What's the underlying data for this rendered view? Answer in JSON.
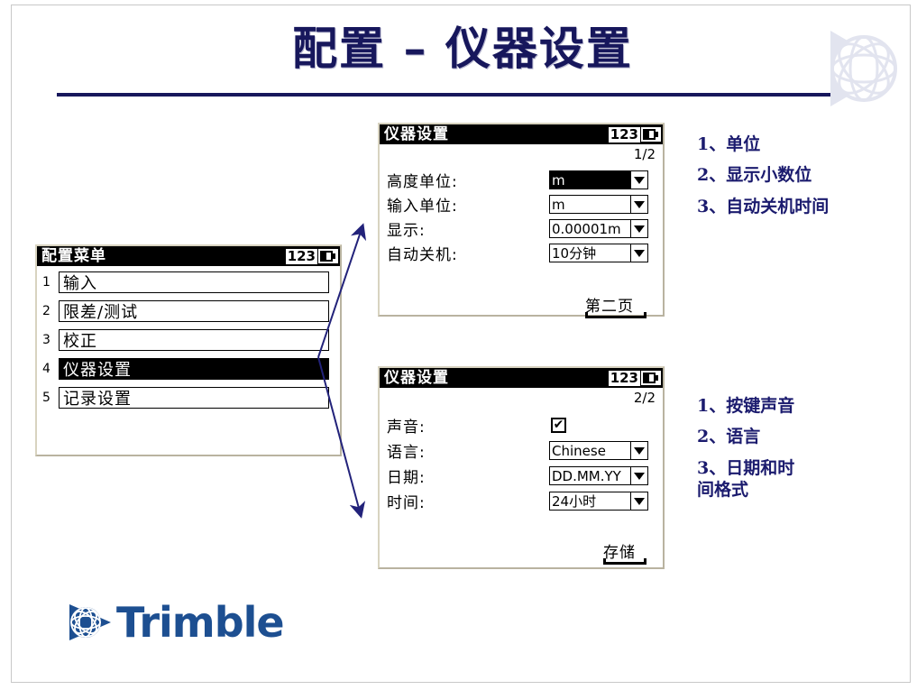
{
  "slide": {
    "title": "配置 – 仪器设置",
    "accent_color": "#17175c",
    "brand_color": "#1d4f91",
    "logo_name": "trimble-globe-logo",
    "footer_wordmark": "Trimble"
  },
  "menu_screen": {
    "title": "配置菜单",
    "badge": "123",
    "battery_icon": "battery-icon",
    "items": [
      {
        "num": "1",
        "label": "输入",
        "selected": false
      },
      {
        "num": "2",
        "label": "限差/测试",
        "selected": false
      },
      {
        "num": "3",
        "label": "校正",
        "selected": false
      },
      {
        "num": "4",
        "label": "仪器设置",
        "selected": true
      },
      {
        "num": "5",
        "label": "记录设置",
        "selected": false
      }
    ]
  },
  "screen1": {
    "title": "仪器设置",
    "badge": "123",
    "battery_icon": "battery-icon",
    "page_indicator": "1/2",
    "fields": [
      {
        "label": "高度单位:",
        "value": "m",
        "selected": true,
        "type": "dropdown"
      },
      {
        "label": "输入单位:",
        "value": "m",
        "selected": false,
        "type": "dropdown"
      },
      {
        "label": "显示:",
        "value": "0.00001m",
        "selected": false,
        "type": "dropdown"
      },
      {
        "label": "自动关机:",
        "value": "10分钟",
        "selected": false,
        "type": "dropdown"
      }
    ],
    "softkey": "第二页"
  },
  "screen2": {
    "title": "仪器设置",
    "badge": "123",
    "battery_icon": "battery-icon",
    "page_indicator": "2/2",
    "fields": [
      {
        "label": "声音:",
        "value": "✔",
        "selected": false,
        "type": "checkbox"
      },
      {
        "label": "语言:",
        "value": "Chinese",
        "selected": false,
        "type": "dropdown"
      },
      {
        "label": "日期:",
        "value": "DD.MM.YY",
        "selected": false,
        "type": "dropdown"
      },
      {
        "label": "时间:",
        "value": "24小时",
        "selected": false,
        "type": "dropdown"
      }
    ],
    "softkey": "存储"
  },
  "annotations_top": {
    "items": [
      "1、单位",
      "2、显示小数位",
      "3、自动关机时间"
    ]
  },
  "annotations_bottom": {
    "items": [
      "1、按键声音",
      "2、语言",
      "3、日期和时间格式"
    ]
  }
}
